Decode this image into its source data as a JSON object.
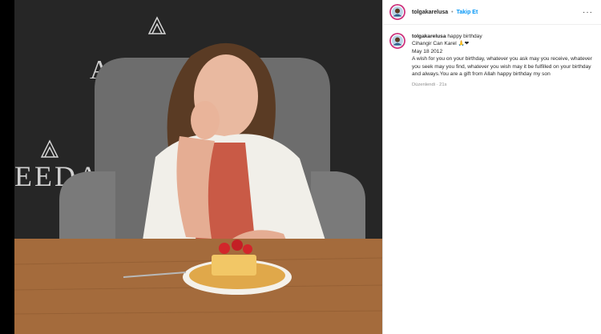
{
  "post": {
    "username": "tolgakarelusa",
    "follow_label": "Takip Et",
    "separator": "•",
    "more_label": "···"
  },
  "caption": {
    "username": "tolgakarelusa",
    "title": "happy birthday",
    "name_line": "Cihangir Can Karel 🙏❤",
    "date_line": "May 18 2012",
    "message": "A wish for you on your birthday, whatever you ask may you receive, whatever you seek may you find, whatever you wish may it be fulfilled on your birthday and always.You are a gift from Allah happy birthday my son",
    "edited": "Düzenlendi",
    "time": "21s"
  },
  "photo": {
    "wall_text_1": "AEEDAM",
    "wall_text_2": "EEDAM"
  },
  "colors": {
    "link": "#0095f6",
    "text": "#262626",
    "muted": "#8e8e8e"
  }
}
